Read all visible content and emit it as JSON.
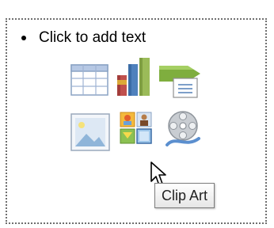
{
  "placeholder": {
    "bullet_text": "Click to add text"
  },
  "content_icons": [
    {
      "name": "insert-table-icon"
    },
    {
      "name": "insert-chart-icon"
    },
    {
      "name": "insert-smartart-icon"
    },
    {
      "name": "insert-picture-icon"
    },
    {
      "name": "clip-art-icon"
    },
    {
      "name": "insert-media-icon"
    }
  ],
  "tooltip": {
    "text": "Clip Art"
  },
  "colors": {
    "border": "#6f6f6f",
    "tooltip_bg": "#ffffff",
    "chart_blue": "#4f81bd",
    "chart_red": "#c0504d",
    "chart_yellow": "#e0b437",
    "smartart_green": "#9bbb59"
  }
}
